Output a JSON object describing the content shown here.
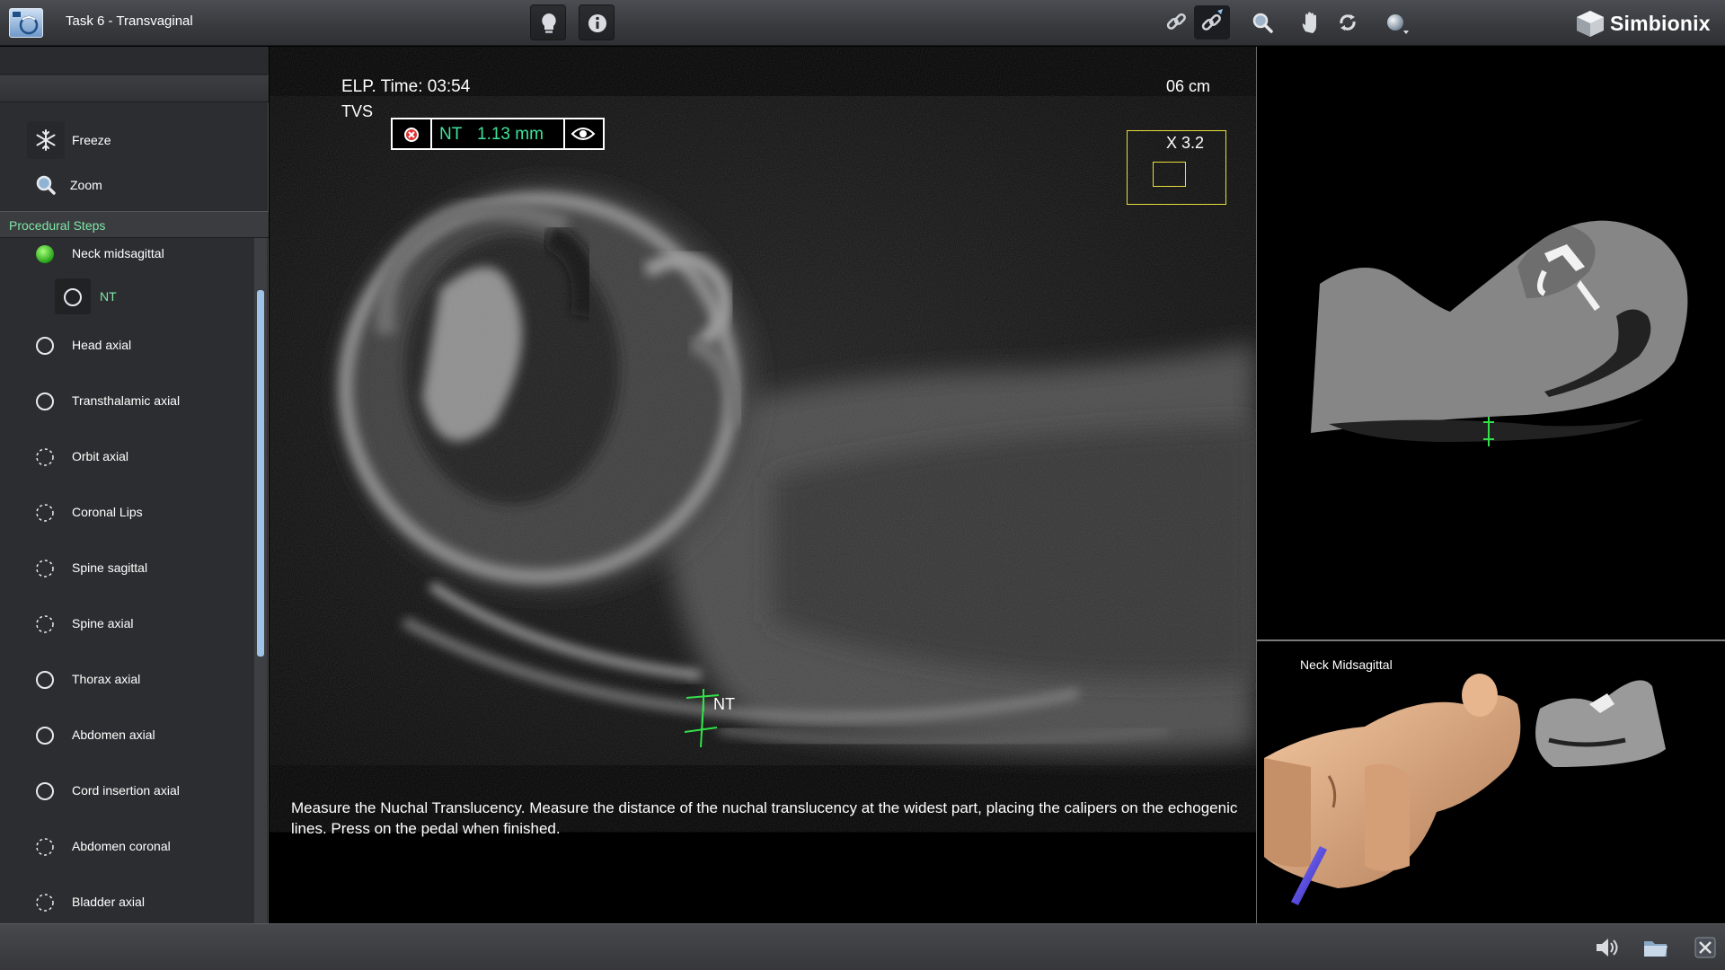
{
  "window": {
    "title": "Task 6 - Transvaginal",
    "brand": "Simbionix"
  },
  "toolbar": {
    "buttons": [
      {
        "icon": "lightbulb-icon"
      },
      {
        "icon": "info-icon"
      },
      {
        "icon": "link-icon"
      },
      {
        "icon": "probe-link-icon",
        "active": true
      },
      {
        "icon": "search-icon"
      },
      {
        "icon": "hand-icon"
      },
      {
        "icon": "rotate-icon"
      },
      {
        "icon": "sphere-dropdown-icon"
      }
    ]
  },
  "sidebar": {
    "tools": [
      {
        "label": "Freeze",
        "icon": "snowflake-icon"
      },
      {
        "label": "Zoom",
        "icon": "zoom-icon"
      }
    ],
    "steps_header": "Procedural Steps",
    "steps": [
      {
        "label": "Neck midsagittal",
        "status": "done"
      },
      {
        "label": "NT",
        "status": "current",
        "substep": true
      },
      {
        "label": "Head axial",
        "status": "open"
      },
      {
        "label": "Transthalamic axial",
        "status": "open"
      },
      {
        "label": "Orbit axial",
        "status": "optional"
      },
      {
        "label": "Coronal Lips",
        "status": "optional"
      },
      {
        "label": "Spine sagittal",
        "status": "optional"
      },
      {
        "label": "Spine axial",
        "status": "optional"
      },
      {
        "label": "Thorax axial",
        "status": "open"
      },
      {
        "label": "Abdomen axial",
        "status": "open"
      },
      {
        "label": "Cord insertion axial",
        "status": "open"
      },
      {
        "label": "Abdomen coronal",
        "status": "optional"
      },
      {
        "label": "Bladder axial",
        "status": "optional"
      }
    ],
    "colors": {
      "accent": "#7fe8a6",
      "done": "#3fcf2a"
    }
  },
  "ultrasound": {
    "elapsed": "ELP. Time: 03:54",
    "mode": "TVS",
    "depth": "06 cm",
    "measurement": {
      "name": "NT",
      "value": "1.13 mm"
    },
    "zoom": "X 3.2",
    "caliper_label": "NT",
    "instruction": "Measure the Nuchal Translucency. Measure the distance of the nuchal translucency at the widest part, placing the calipers on the echogenic lines. Press on the pedal when finished."
  },
  "model_panel": {
    "title": "Neck Midsagittal"
  },
  "bottombar": {
    "buttons": [
      {
        "icon": "speaker-icon"
      },
      {
        "icon": "folder-icon"
      },
      {
        "icon": "close-icon"
      }
    ]
  }
}
